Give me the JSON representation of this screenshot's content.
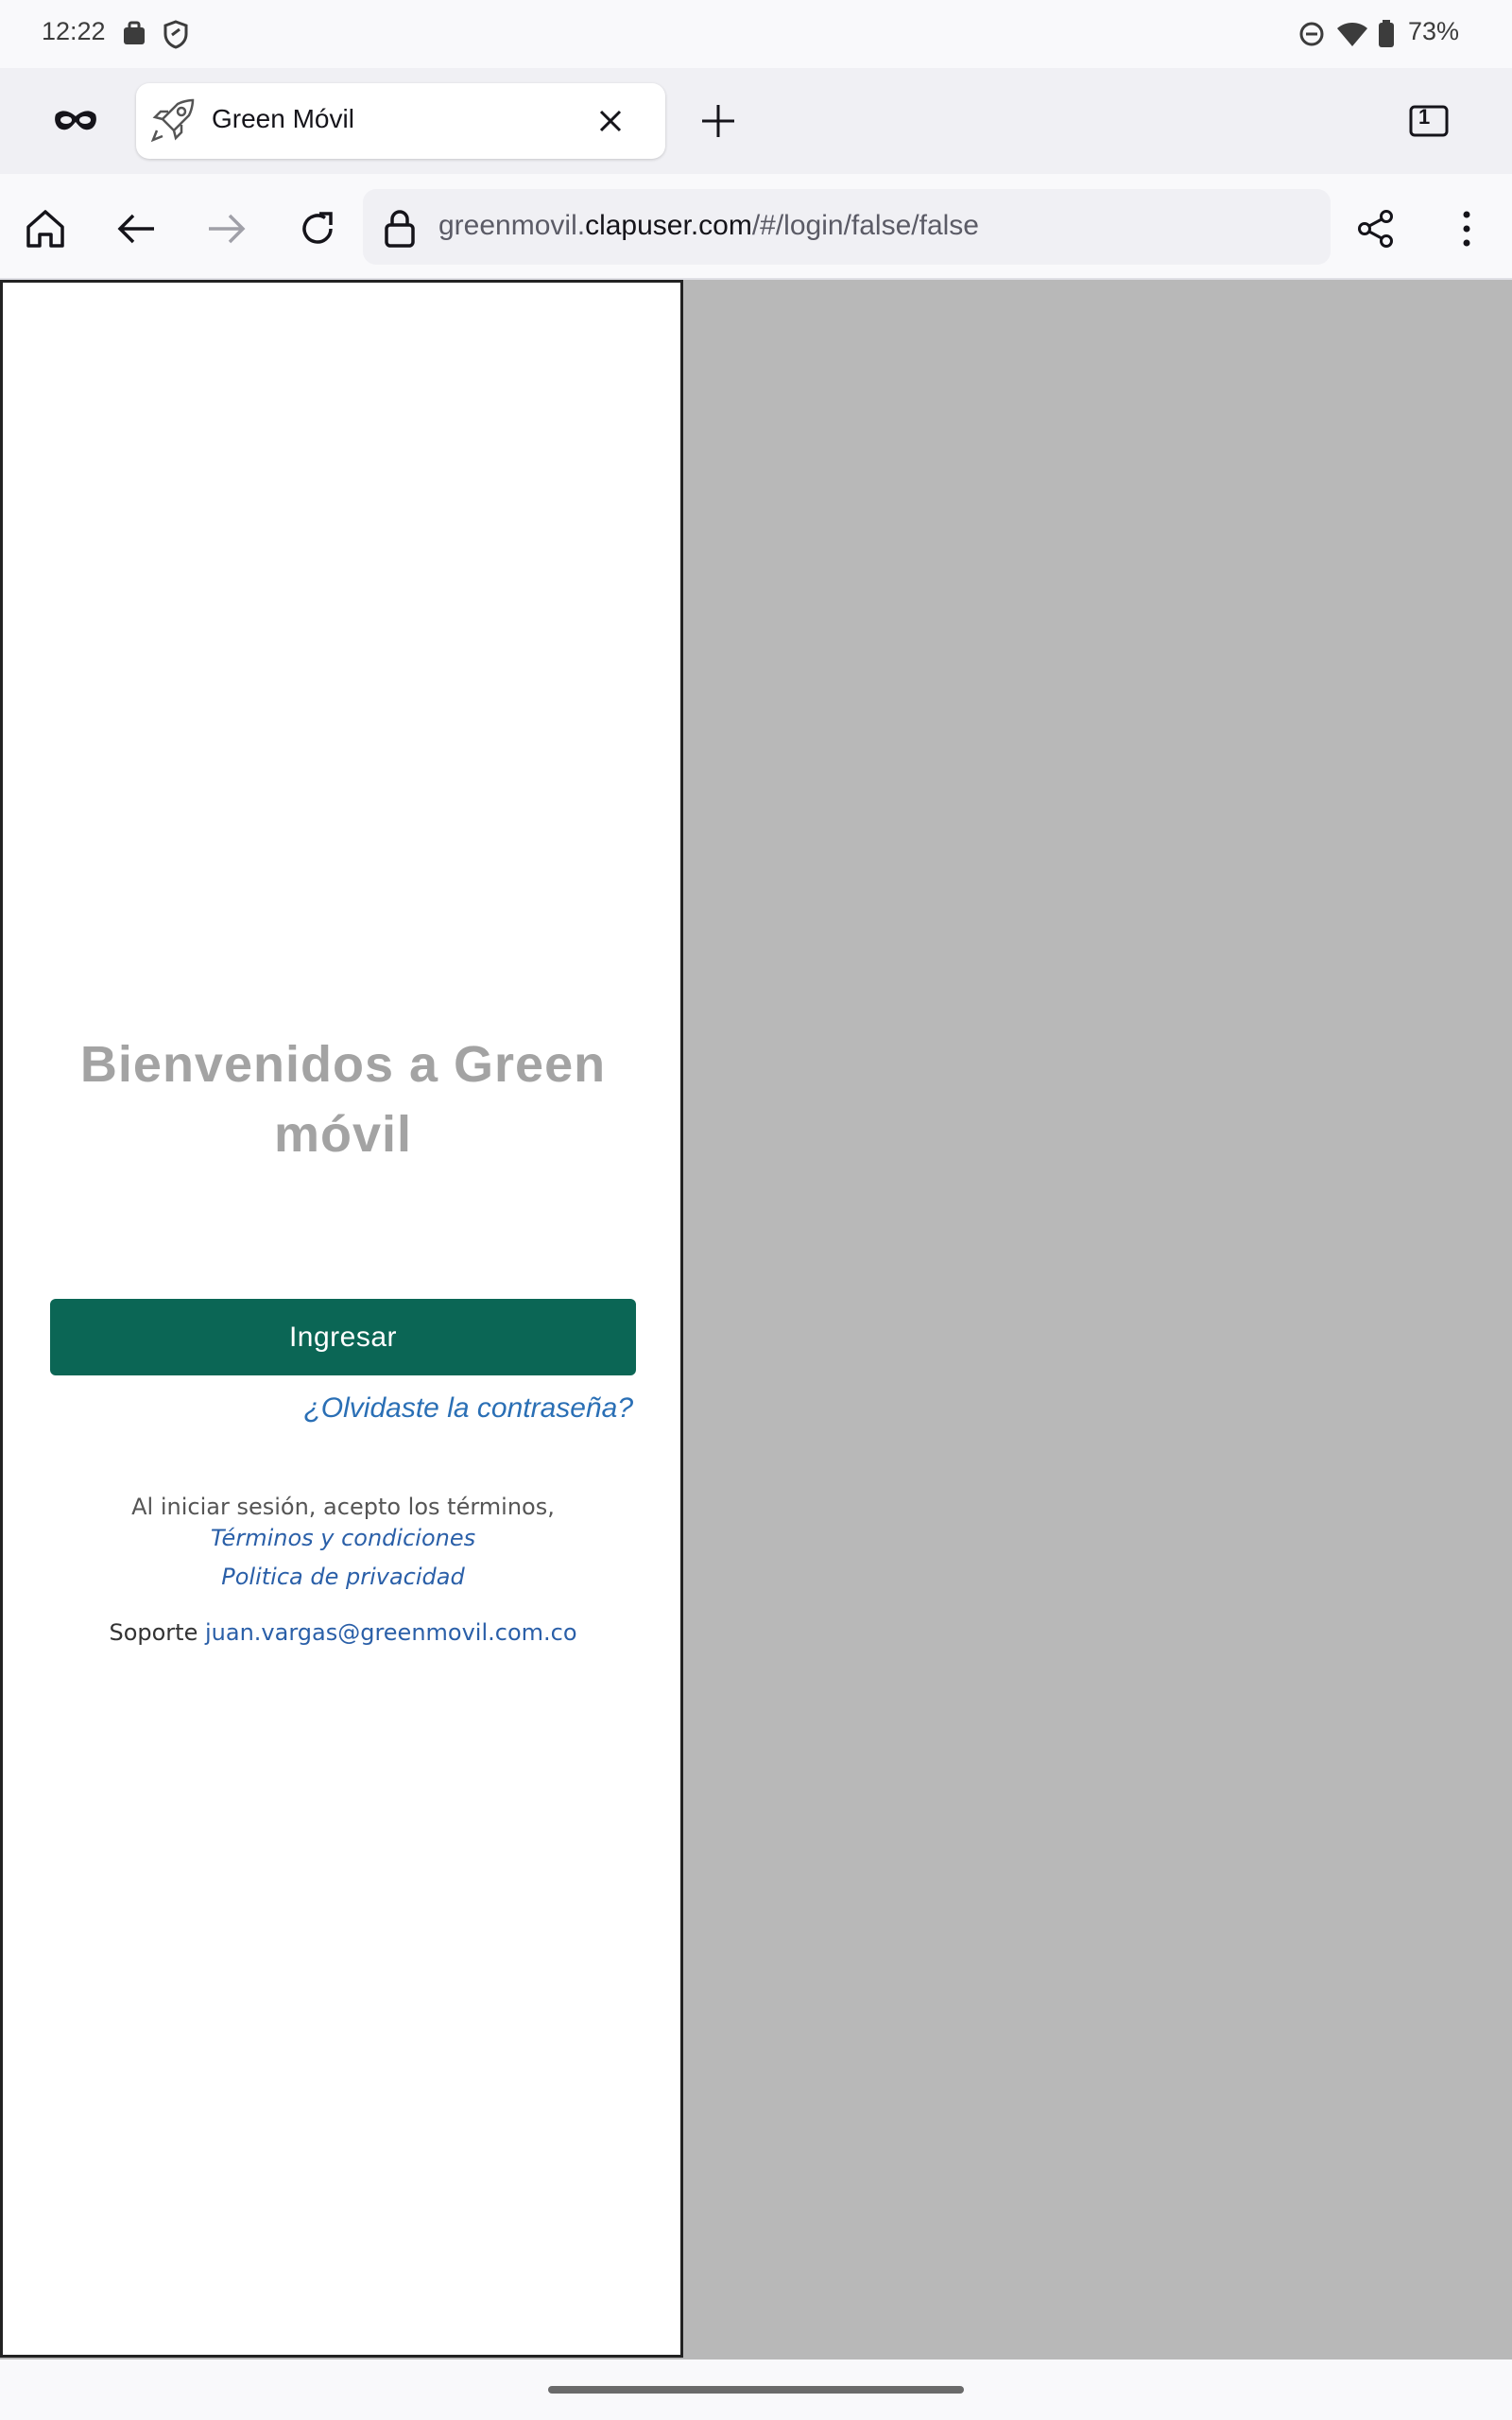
{
  "status_bar": {
    "time": "12:22",
    "battery": "73%",
    "icons": [
      "briefcase-icon",
      "shield-icon",
      "do-not-disturb-icon",
      "wifi-icon",
      "battery-icon"
    ]
  },
  "tabs": {
    "private_mode_icon": "mask-icon",
    "active_tab": {
      "title": "Green Móvil",
      "favicon": "rocket-icon"
    },
    "new_tab_icon": "plus-icon",
    "tab_count": "1"
  },
  "toolbar": {
    "url_prefix": "greenmovil.",
    "url_domain": "clapuser.com",
    "url_path": "/#/login/false/false"
  },
  "login": {
    "welcome": "Bienvenidos a Green móvil",
    "login_button": "Ingresar",
    "forgot_password": "¿Olvidaste la contraseña?",
    "terms_intro": "Al iniciar sesión, acepto los términos,",
    "terms_link": "Términos y condiciones",
    "privacy_link": "Politica de privacidad",
    "support_label": "Soporte",
    "support_email": "juan.vargas@greenmovil.com.co"
  },
  "colors": {
    "primary": "#0b6655",
    "link": "#2a6fb5",
    "background_outside": "#b8b8b8"
  }
}
